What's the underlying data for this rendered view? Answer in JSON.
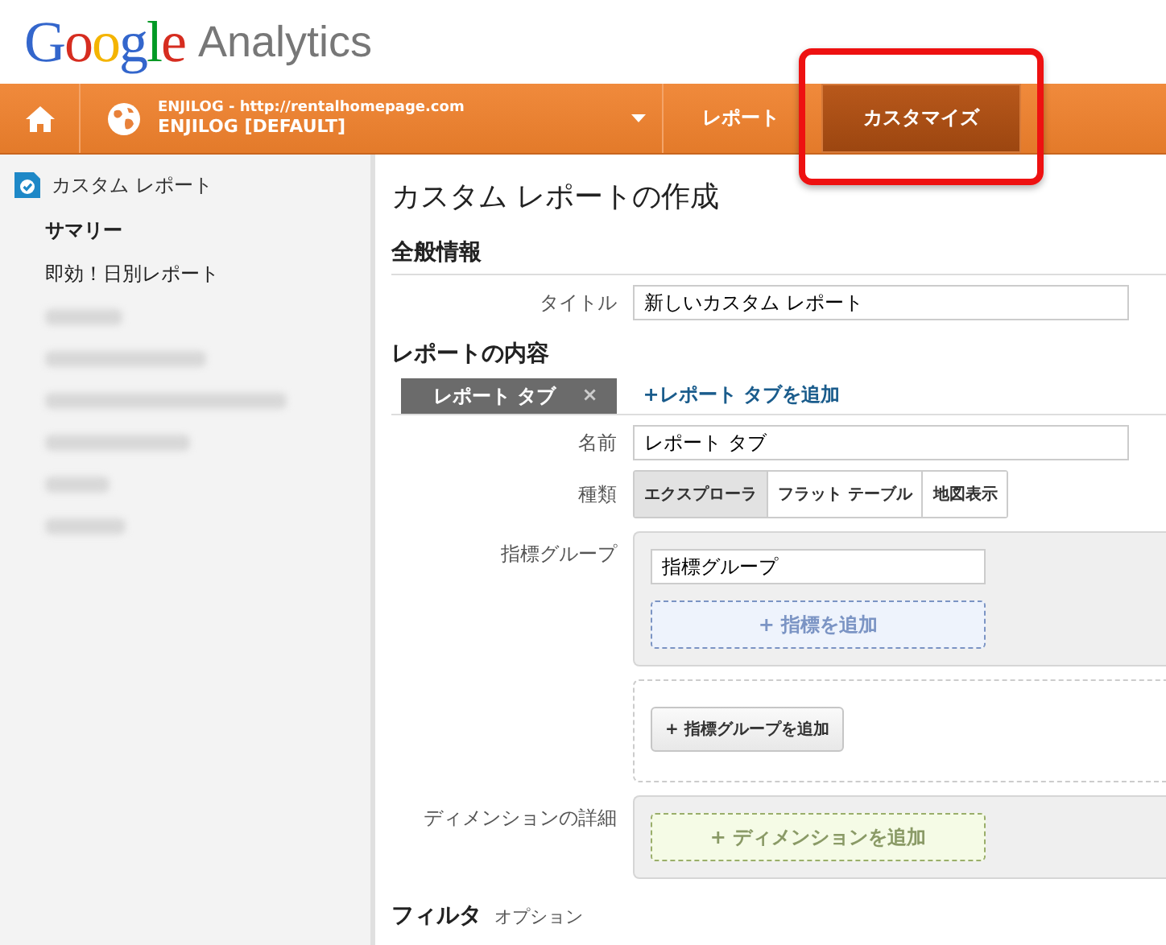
{
  "header": {
    "logo": "Google",
    "product": "Analytics"
  },
  "nav": [
    {
      "kind": "home"
    },
    {
      "kind": "property",
      "account": "ENJILOG - http://rentalhomepage.com",
      "view": "ENJILOG [DEFAULT]"
    },
    {
      "kind": "tab",
      "label": "レポート",
      "selected": false,
      "highlighted": false
    },
    {
      "kind": "tab",
      "label": "カスタマイズ",
      "selected": true,
      "highlighted": true
    }
  ],
  "sidebar": {
    "heading": "カスタム レポート",
    "items": [
      {
        "kind": "link",
        "label": "サマリー",
        "selected": true
      },
      {
        "kind": "link",
        "label": "即効！日別レポート",
        "selected": false
      },
      {
        "kind": "blurred"
      },
      {
        "kind": "blurred"
      },
      {
        "kind": "blurred"
      },
      {
        "kind": "blurred"
      },
      {
        "kind": "blurred"
      },
      {
        "kind": "blurred"
      }
    ]
  },
  "page": {
    "title": "カスタム レポートの作成",
    "general": {
      "heading": "全般情報",
      "title_label": "タイトル",
      "title_value": "新しいカスタム レポート"
    },
    "content": {
      "heading": "レポートの内容",
      "tabs": [
        {
          "label": "レポート タブ",
          "close": "×",
          "selected": true
        }
      ],
      "add_tab": "+レポート タブを追加",
      "name_label": "名前",
      "name_value": "レポート タブ",
      "type_label": "種類",
      "types": [
        {
          "label": "エクスプローラ",
          "selected": true
        },
        {
          "label": "フラット テーブル",
          "selected": false
        },
        {
          "label": "地図表示",
          "selected": false
        }
      ],
      "metric_label": "指標グループ",
      "metric_group_value": "指標グループ",
      "add_metric": "+ 指標を追加",
      "add_metric_group": "+ 指標グループを追加",
      "dimension_label": "ディメンションの詳細",
      "add_dimension": "+ ディメンションを追加"
    },
    "filter": {
      "heading": "フィルタ",
      "note": "オプション"
    }
  }
}
